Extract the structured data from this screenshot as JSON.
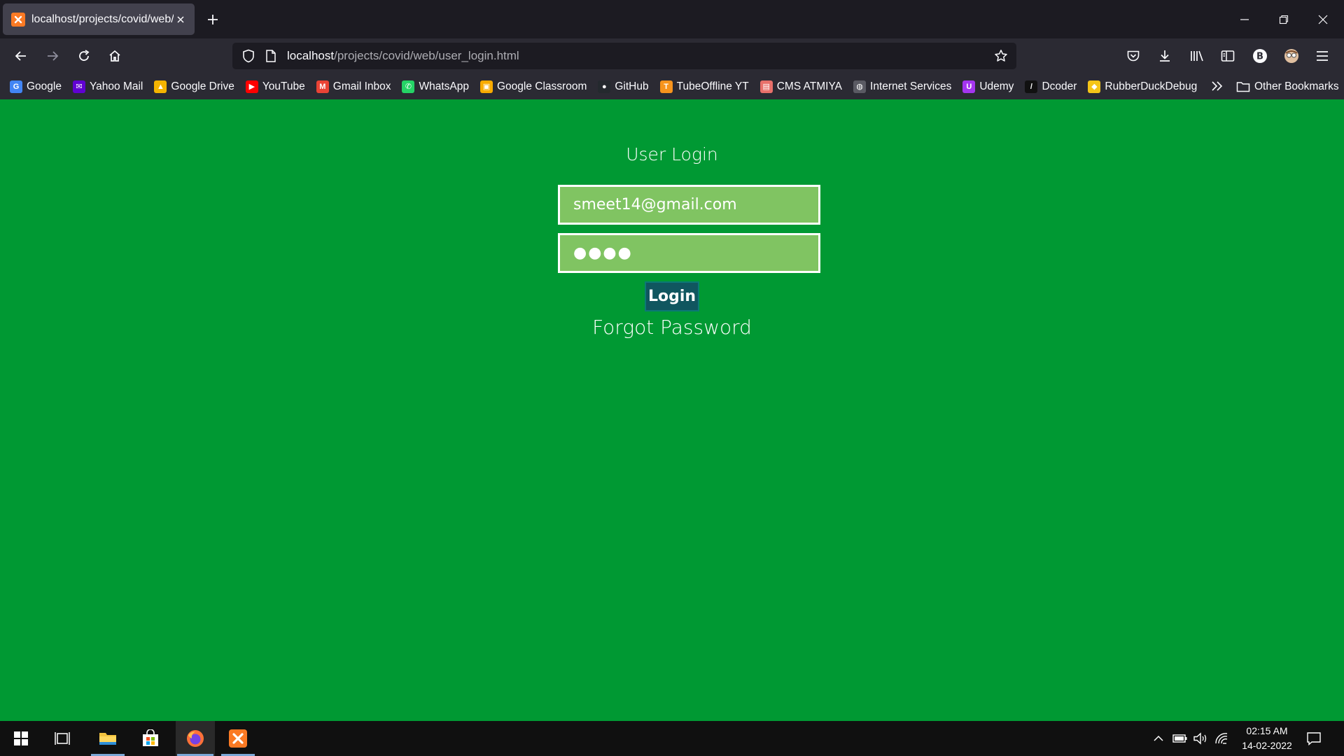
{
  "browser": {
    "tab": {
      "title": "localhost/projects/covid/web/user_login.html",
      "favicon_color": "#fb7a24"
    },
    "url": {
      "host": "localhost",
      "path": "/projects/covid/web/user_login.html"
    },
    "bookmarks": [
      {
        "label": "Google",
        "icon": "google-icon",
        "color": "#4285f4",
        "glyph": "G"
      },
      {
        "label": "Yahoo Mail",
        "icon": "yahoo-mail-icon",
        "color": "#6001d2",
        "glyph": "✉"
      },
      {
        "label": "Google Drive",
        "icon": "google-drive-icon",
        "color": "#f4b400",
        "glyph": "▲"
      },
      {
        "label": "YouTube",
        "icon": "youtube-icon",
        "color": "#ff0000",
        "glyph": "▶"
      },
      {
        "label": "Gmail Inbox",
        "icon": "gmail-icon",
        "color": "#ea4335",
        "glyph": "M"
      },
      {
        "label": "WhatsApp",
        "icon": "whatsapp-icon",
        "color": "#25d366",
        "glyph": "✆"
      },
      {
        "label": "Google Classroom",
        "icon": "google-classroom-icon",
        "color": "#f9ab00",
        "glyph": "▣"
      },
      {
        "label": "GitHub",
        "icon": "github-icon",
        "color": "#24292e",
        "glyph": "●"
      },
      {
        "label": "TubeOffline YT",
        "icon": "tubeoffline-icon",
        "color": "#f7941d",
        "glyph": "T"
      },
      {
        "label": "CMS ATMIYA",
        "icon": "cms-atmiya-icon",
        "color": "#e8706a",
        "glyph": "▤"
      },
      {
        "label": "Internet Services",
        "icon": "globe-icon",
        "color": "#5a5a63",
        "glyph": "◍"
      },
      {
        "label": "Udemy",
        "icon": "udemy-icon",
        "color": "#a435f0",
        "glyph": "U"
      },
      {
        "label": "Dcoder",
        "icon": "dcoder-icon",
        "color": "#111111",
        "glyph": "/"
      },
      {
        "label": "RubberDuckDebug",
        "icon": "rubber-duck-icon",
        "color": "#f5c518",
        "glyph": "◆"
      }
    ],
    "other_bookmarks": "Other Bookmarks"
  },
  "login": {
    "heading": "User Login",
    "email_value": "smeet14@gmail.com",
    "password_mask": "●●●●",
    "button": "Login",
    "forgot": "Forgot Password"
  },
  "taskbar": {
    "time": "02:15 AM",
    "date": "14-02-2022"
  },
  "colors": {
    "page_bg": "#009933",
    "field_bg": "#80c462",
    "button_bg": "#10565f"
  }
}
